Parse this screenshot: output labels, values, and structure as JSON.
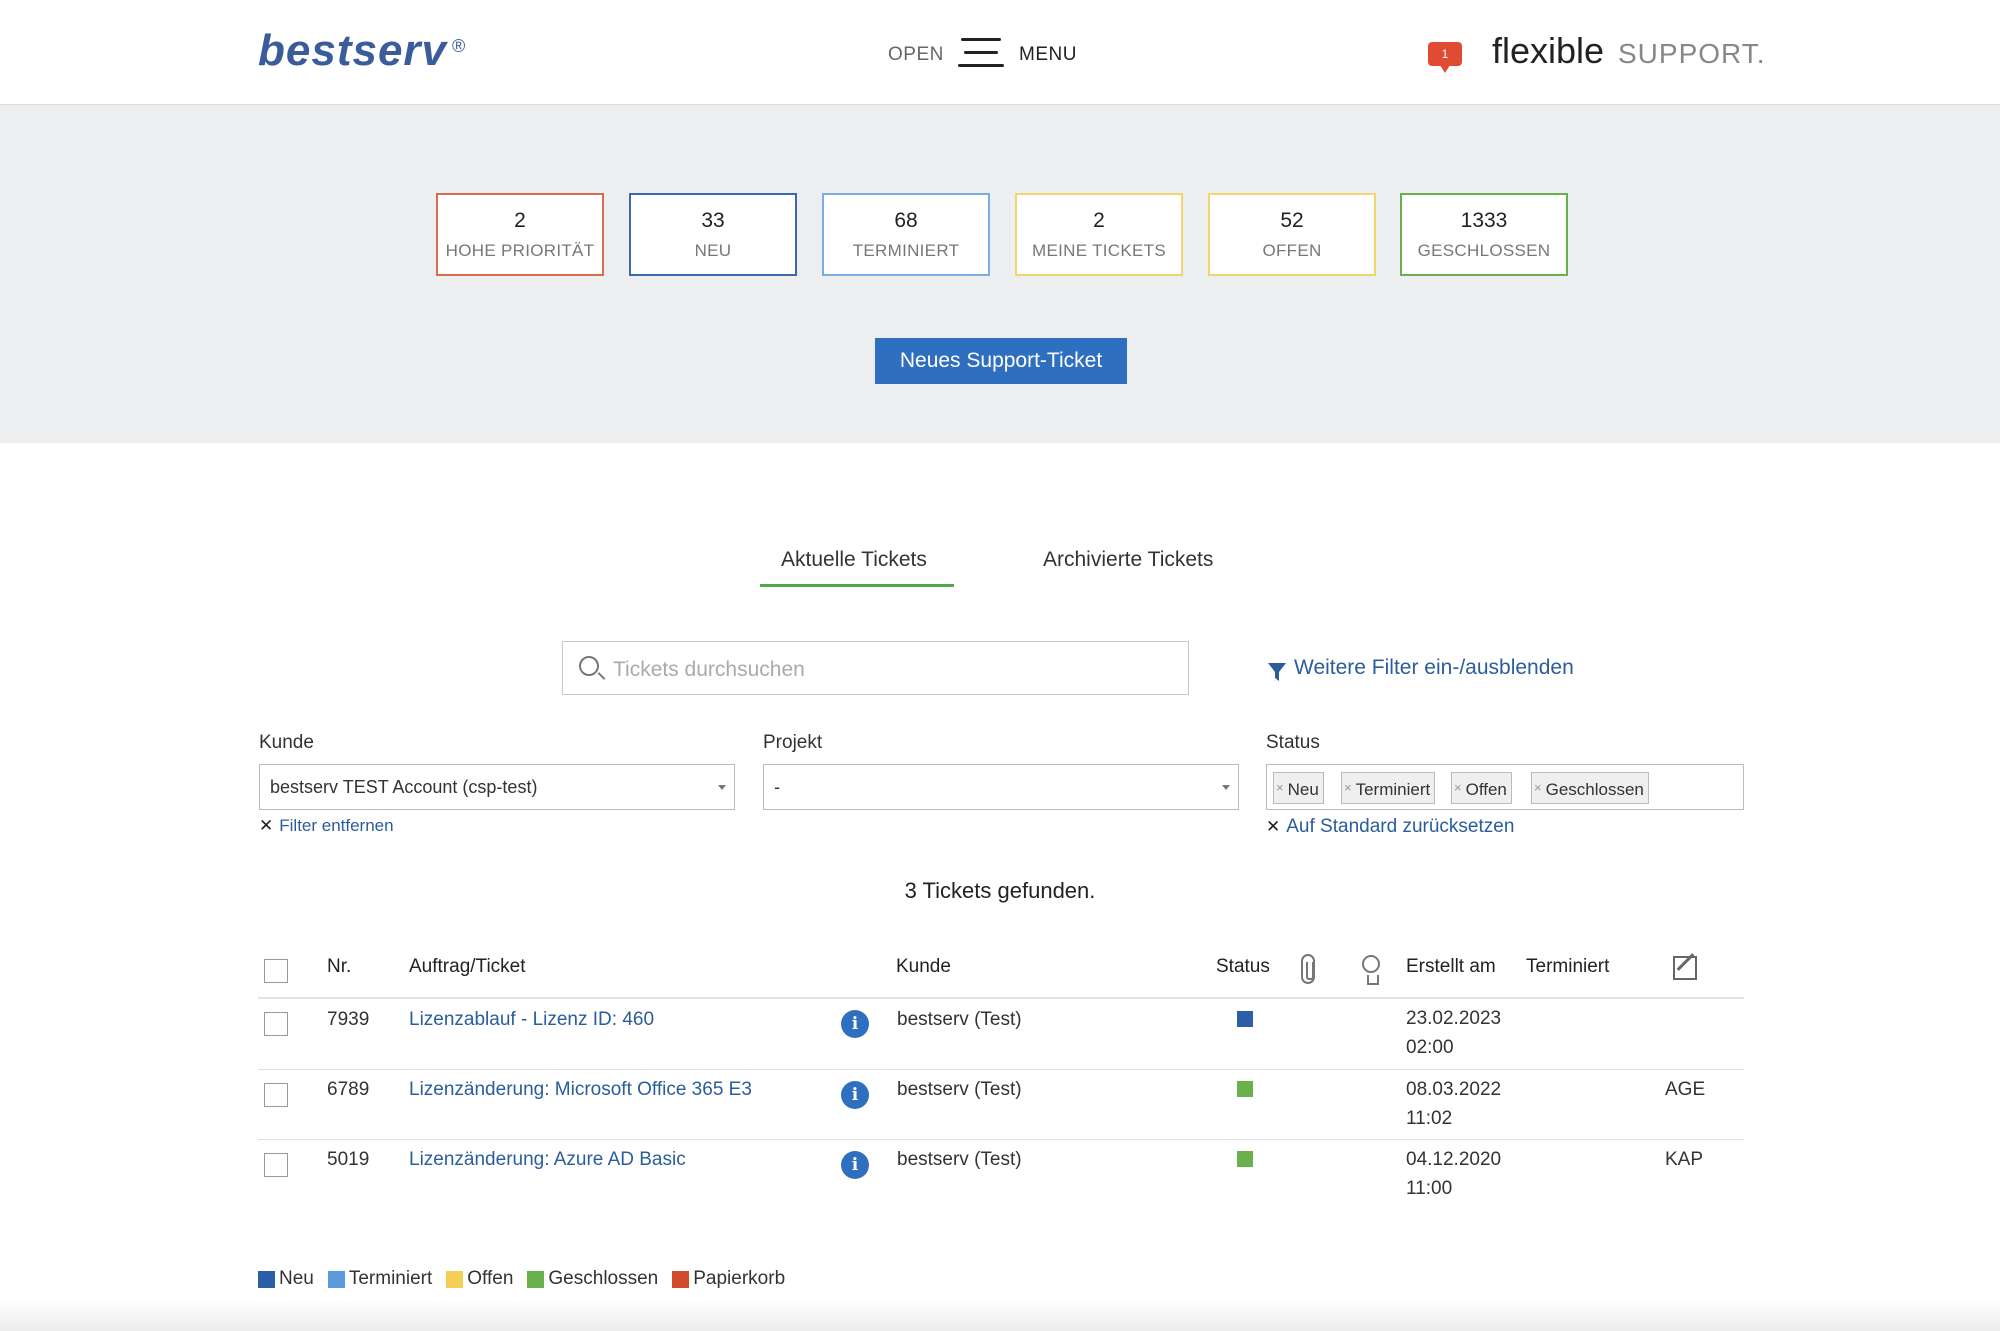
{
  "header": {
    "logo": "bestserv",
    "logo_reg": "®",
    "menu_open": "OPEN",
    "menu_label": "MENU",
    "notification_count": "1",
    "brand_flexible": "flexible",
    "brand_support": "SUPPORT."
  },
  "stats": [
    {
      "num": "2",
      "label": "HOHE PRIORITÄT",
      "color": "#d9694f"
    },
    {
      "num": "33",
      "label": "NEU",
      "color": "#3a69ad"
    },
    {
      "num": "68",
      "label": "TERMINIERT",
      "color": "#7aaee0"
    },
    {
      "num": "2",
      "label": "MEINE TICKETS",
      "color": "#f0d66b"
    },
    {
      "num": "52",
      "label": "OFFEN",
      "color": "#f0d66b"
    },
    {
      "num": "1333",
      "label": "GESCHLOSSEN",
      "color": "#6ab04c"
    }
  ],
  "new_ticket_button": "Neues Support-Ticket",
  "tabs": {
    "current": "Aktuelle Tickets",
    "archived": "Archivierte Tickets"
  },
  "search": {
    "placeholder": "Tickets durchsuchen"
  },
  "filter_toggle": "Weitere Filter ein-/ausblenden",
  "filters": {
    "kunde_label": "Kunde",
    "kunde_value": "bestserv TEST Account (csp-test)",
    "kunde_clear": "Filter entfernen",
    "projekt_label": "Projekt",
    "projekt_value": "-",
    "status_label": "Status",
    "status_tags": [
      "Neu",
      "Terminiert",
      "Offen",
      "Geschlossen"
    ],
    "status_reset": "Auf Standard zurücksetzen",
    "tag_remove": "×",
    "clear_mark": "✕"
  },
  "result_count": "3 Tickets gefunden.",
  "table": {
    "headers": {
      "nr": "Nr.",
      "ticket": "Auftrag/Ticket",
      "kunde": "Kunde",
      "status": "Status",
      "erstellt": "Erstellt am",
      "terminiert": "Terminiert"
    },
    "info_glyph": "i",
    "rows": [
      {
        "nr": "7939",
        "title": "Lizenzablauf - Lizenz ID: 460",
        "kunde": "bestserv (Test)",
        "status_color": "#2a5fa8",
        "date": "23.02.2023",
        "time": "02:00",
        "terminiert": ""
      },
      {
        "nr": "6789",
        "title": "Lizenzänderung: Microsoft Office 365 E3",
        "kunde": "bestserv (Test)",
        "status_color": "#6ab04c",
        "date": "08.03.2022",
        "time": "11:02",
        "terminiert": "AGE"
      },
      {
        "nr": "5019",
        "title": "Lizenzänderung: Azure AD Basic",
        "kunde": "bestserv (Test)",
        "status_color": "#6ab04c",
        "date": "04.12.2020",
        "time": "11:00",
        "terminiert": "KAP"
      }
    ]
  },
  "legend": [
    {
      "label": "Neu",
      "color": "#2a5fa8"
    },
    {
      "label": "Terminiert",
      "color": "#5b9bdc"
    },
    {
      "label": "Offen",
      "color": "#f3cf55"
    },
    {
      "label": "Geschlossen",
      "color": "#6ab04c"
    },
    {
      "label": "Papierkorb",
      "color": "#d04a2c"
    }
  ]
}
